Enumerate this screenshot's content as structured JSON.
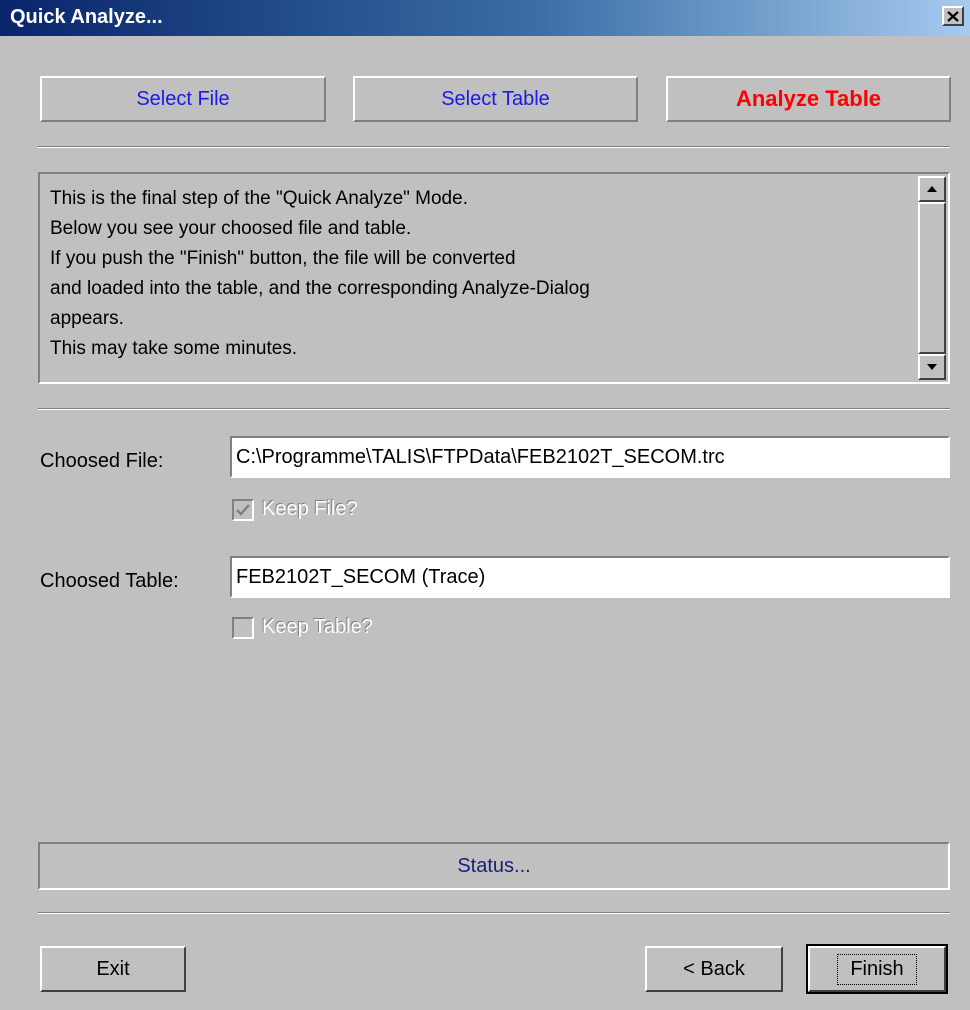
{
  "window": {
    "title": "Quick Analyze..."
  },
  "steps": [
    {
      "label": "Select File"
    },
    {
      "label": "Select Table"
    },
    {
      "label": "Analyze Table"
    }
  ],
  "info": {
    "text": "This is the final step of the \"Quick Analyze\" Mode.\nBelow you see your choosed file and table.\nIf you push the \"Finish\" button, the file will be converted\nand loaded into the table, and the corresponding Analyze-Dialog\nappears.\nThis may take some minutes."
  },
  "file": {
    "label": "Choosed File:",
    "value": "C:\\Programme\\TALIS\\FTPData\\FEB2102T_SECOM.trc",
    "keep_label": "Keep File?",
    "keep_checked": true
  },
  "table": {
    "label": "Choosed Table:",
    "value": "FEB2102T_SECOM (Trace)",
    "keep_label": "Keep Table?",
    "keep_checked": false
  },
  "status": {
    "text": "Status..."
  },
  "buttons": {
    "exit": "Exit",
    "back": "< Back",
    "finish": "Finish"
  },
  "colors": {
    "step_inactive": "#1a1ae6",
    "step_active": "#ff0000",
    "face": "#c0c0c0"
  },
  "icons": {
    "close": "close-icon",
    "scroll_up": "arrow-up-icon",
    "scroll_down": "arrow-down-icon",
    "check": "checkmark-icon"
  }
}
